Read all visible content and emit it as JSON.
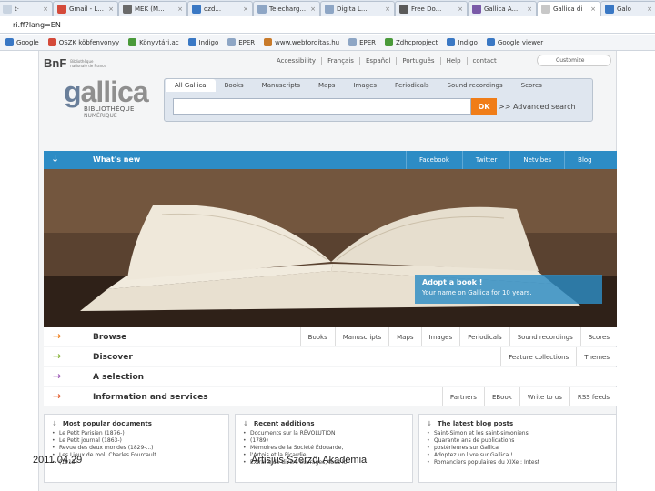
{
  "browser": {
    "tabs": [
      {
        "label": "t·",
        "color": "#c8d3e0"
      },
      {
        "label": "Gmail - L...",
        "color": "#d44a3a"
      },
      {
        "label": "MEK (M...",
        "color": "#6a6a6a"
      },
      {
        "label": "ozd...",
        "color": "#3a78c4"
      },
      {
        "label": "Telecharg...",
        "color": "#8ea6c5"
      },
      {
        "label": "Digita L...",
        "color": "#8ea6c5"
      },
      {
        "label": "Free Do...",
        "color": "#5a5a5a"
      },
      {
        "label": "Gallica A...",
        "color": "#7a5aa8"
      },
      {
        "label": "Gallica di",
        "color": "#c8c8c8"
      },
      {
        "label": "Galo",
        "color": "#3a78c4"
      }
    ],
    "url": "ri.ff?lang=EN",
    "bookmarks": [
      {
        "label": "Google",
        "color": "#3a78c4"
      },
      {
        "label": "OSZK köbfenvonyy",
        "color": "#d44a3a"
      },
      {
        "label": "Könyvtári.ac",
        "color": "#4a9a3a"
      },
      {
        "label": "Indigo",
        "color": "#3a78c4"
      },
      {
        "label": "EPER",
        "color": "#8ea6c5"
      },
      {
        "label": "www.webfordítas.hu",
        "color": "#c87a2a"
      },
      {
        "label": "EPER",
        "color": "#8ea6c5"
      },
      {
        "label": "Zdhcpropject",
        "color": "#4a9a3a"
      },
      {
        "label": "Indigo",
        "color": "#3a78c4"
      },
      {
        "label": "Google viewer",
        "color": "#3a78c4"
      }
    ]
  },
  "header": {
    "bnf_mark": "BnF",
    "bnf_sub": "Bibliothèque nationale de France",
    "links": [
      "Accessibility",
      "Français",
      "Español",
      "Português",
      "Help",
      "contact"
    ],
    "custom_button": "Customize"
  },
  "logo": {
    "text_g": "g",
    "text_rest": "allica",
    "line1": "BIBLIOTHÈQUE",
    "line2": "NUMÉRIQUE"
  },
  "search": {
    "tabs": [
      "All Gallica",
      "Books",
      "Manuscripts",
      "Maps",
      "Images",
      "Periodicals",
      "Sound recordings",
      "Scores"
    ],
    "placeholder": "",
    "ok_label": "OK",
    "advanced_label": ">> Advanced search"
  },
  "whats_new": {
    "title": "What's new",
    "links": [
      "Facebook",
      "Twitter",
      "Netvibes",
      "Blog"
    ],
    "adopt_title": "Adopt a book !",
    "adopt_sub": "Your name on Gallica for 10 years."
  },
  "rows": [
    {
      "title": "Browse",
      "arrow_color": "#f07d18",
      "links": [
        "Books",
        "Manuscripts",
        "Maps",
        "Images",
        "Periodicals",
        "Sound recordings",
        "Scores"
      ]
    },
    {
      "title": "Discover",
      "arrow_color": "#86b339",
      "links": [
        "Feature collections",
        "Themes"
      ]
    },
    {
      "title": "A selection",
      "arrow_color": "#9b59b6",
      "links": []
    },
    {
      "title": "Information and services",
      "arrow_color": "#e25b2a",
      "links": [
        "Partners",
        "EBook",
        "Write to us",
        "RSS feeds"
      ]
    }
  ],
  "columns": [
    {
      "title": "Most popular documents",
      "items": [
        "Le Petit Parisien (1876-)",
        "Le Petit journal (1863-)",
        "Revue des deux mondes (1829-...)",
        "Les Lieux de mol, Charles Fourcault",
        "(1913)"
      ]
    },
    {
      "title": "Recent additions",
      "items": [
        "Documents sur la RÉVOLUTION",
        "(1789)",
        "Mémoires de la Société Édouarde,",
        "l'Artois et la Picardie",
        "Extraits de divers ouvrages, tous lo"
      ]
    },
    {
      "title": "The latest blog posts",
      "items": [
        "Saint-Simon et les saint-simoniens",
        "Quarante ans de publications",
        "postérieures sur Gallica",
        "Adoptez un livre sur Gallica !",
        "Romanciers populaires du XIXe : Intest"
      ]
    }
  ],
  "footer": {
    "date": "2011.04.29",
    "org": "Artisjus Szerzői Akadémia"
  }
}
